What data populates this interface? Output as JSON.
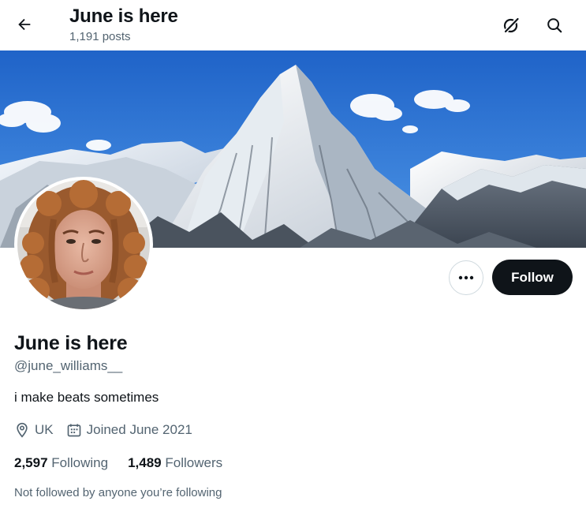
{
  "header": {
    "title": "June is here",
    "posts_count": "1,191 posts",
    "back_icon": "arrow-left-icon",
    "grok_icon": "grok-icon",
    "search_icon": "search-icon"
  },
  "profile": {
    "display_name": "June is here",
    "handle": "@june_williams__",
    "bio": "i make beats sometimes",
    "location": "UK",
    "joined": "Joined June 2021",
    "following_count": "2,597",
    "following_label": "Following",
    "followers_count": "1,489",
    "followers_label": "Followers",
    "not_followed_text": "Not followed by anyone you’re following"
  },
  "actions": {
    "follow_label": "Follow",
    "more_icon": "more-dots-icon"
  },
  "colors": {
    "primary_text": "#0f1419",
    "secondary_text": "#536471",
    "follow_button_bg": "#0f1419",
    "border": "#cfd9de",
    "sky": "#2a6fd0"
  }
}
